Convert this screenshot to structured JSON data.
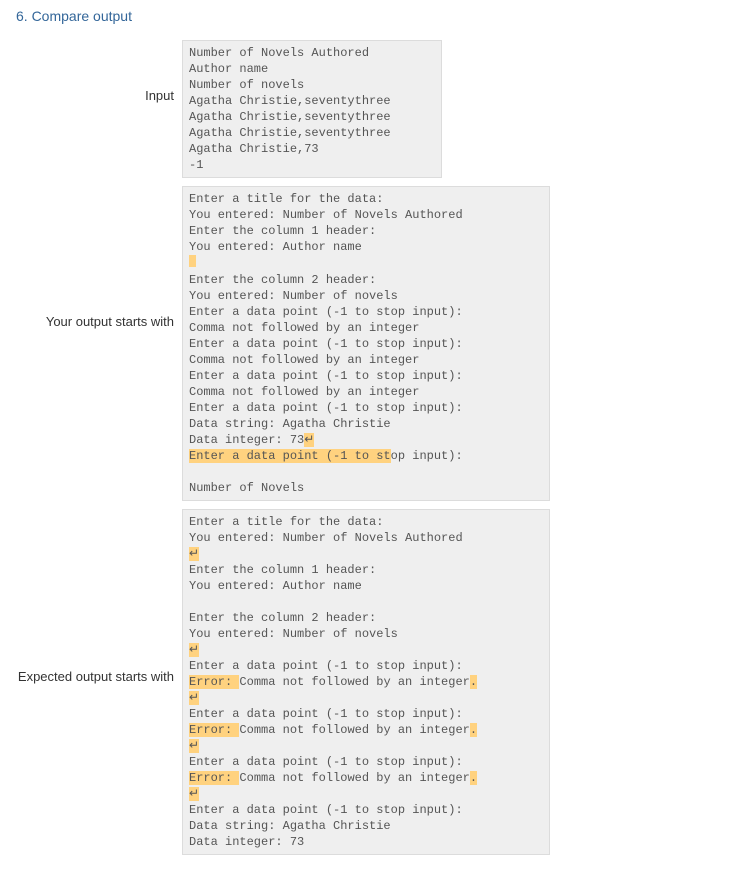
{
  "section": {
    "title": "6. Compare output"
  },
  "labels": {
    "input": "Input",
    "your_output": "Your output starts with",
    "expected": "Expected output starts with"
  },
  "blocks": {
    "input": {
      "l1": "Number of Novels Authored",
      "l2": "Author name",
      "l3": "Number of novels",
      "l4": "Agatha Christie,seventythree",
      "l5": "Agatha Christie,seventythree",
      "l6": "Agatha Christie,seventythree",
      "l7": "Agatha Christie,73",
      "l8": "-1"
    },
    "your": {
      "l1": "Enter a title for the data:",
      "l2": "You entered: Number of Novels Authored",
      "l3": "Enter the column 1 header:",
      "l4": "You entered: Author name",
      "blank1": "",
      "l6": "Enter the column 2 header:",
      "l7": "You entered: Number of novels",
      "l8": "Enter a data point (-1 to stop input):",
      "l9": "Comma not followed by an integer",
      "l10": "Enter a data point (-1 to stop input):",
      "l11": "Comma not followed by an integer",
      "l12": "Enter a data point (-1 to stop input):",
      "l13": "Comma not followed by an integer",
      "l14": "Enter a data point (-1 to stop input):",
      "l15": "Data string: Agatha Christie",
      "l16a": "Data integer: 73",
      "l16b": "↵",
      "l17a": "Enter a data point (-1 to st",
      "l17b": "op input):",
      "blank2": "",
      "l19": "Number of Novels"
    },
    "expected": {
      "l1": "Enter a title for the data:",
      "l2": "You entered: Number of Novels Authored",
      "l3m": "↵",
      "l4": "Enter the column 1 header:",
      "l5": "You entered: Author name",
      "blank1": "",
      "l7": "Enter the column 2 header:",
      "l8": "You entered: Number of novels",
      "l9m": "↵",
      "l10": "Enter a data point (-1 to stop input):",
      "err": "Error: ",
      "l11b": "Comma not followed by an integer",
      "l11c": ".",
      "l12m": "↵",
      "l13": "Enter a data point (-1 to stop input):",
      "l14b": "Comma not followed by an integer",
      "l14c": ".",
      "l15m": "↵",
      "l16": "Enter a data point (-1 to stop input):",
      "l17b": "Comma not followed by an integer",
      "l17c": ".",
      "l18m": "↵",
      "l19": "Enter a data point (-1 to stop input):",
      "l20": "Data string: Agatha Christie",
      "l21": "Data integer: 73"
    }
  }
}
